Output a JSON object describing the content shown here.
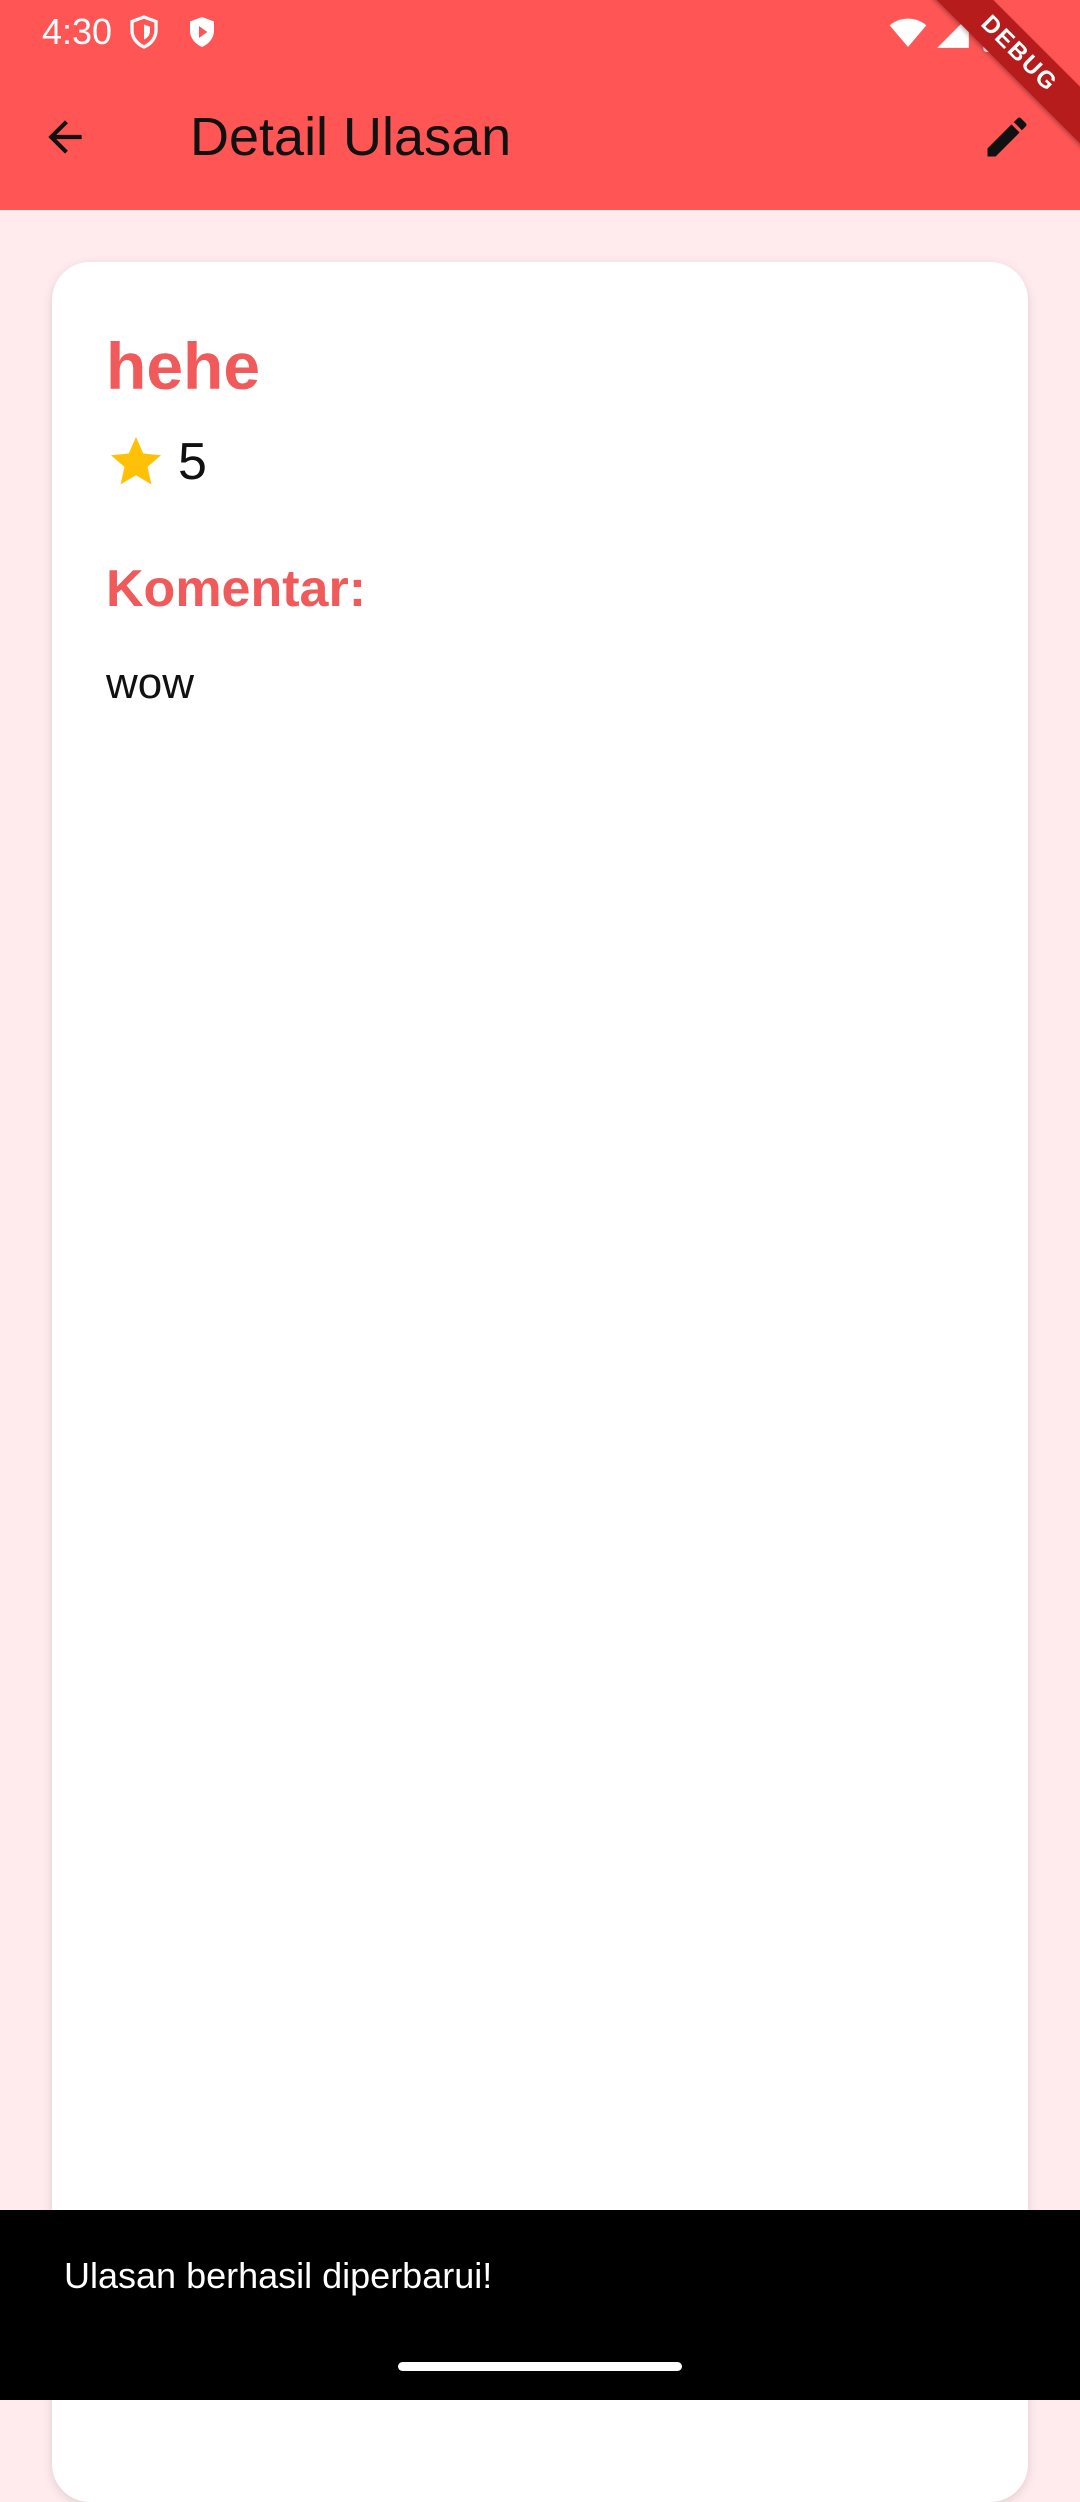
{
  "status_bar": {
    "time": "4:30",
    "left_icons": [
      "shield-icon",
      "play-protect-icon"
    ],
    "right_icons": [
      "wifi-icon",
      "cellular-signal-icon",
      "battery-icon"
    ]
  },
  "app_bar": {
    "title": "Detail Ulasan",
    "back_icon": "arrow-back-icon",
    "edit_icon": "pencil-icon",
    "background": "#FF5555"
  },
  "debug_banner": {
    "label": "DEBUG"
  },
  "review": {
    "title": "hehe",
    "rating": "5",
    "rating_icon": "star-icon",
    "comment_label": "Komentar:",
    "comment": "wow",
    "accent_color": "#F05A5A",
    "star_color": "#FFC107"
  },
  "snackbar": {
    "message": "Ulasan berhasil diperbarui!"
  },
  "colors": {
    "page_background": "#FFEBEE",
    "card_background": "#FFFFFF"
  }
}
